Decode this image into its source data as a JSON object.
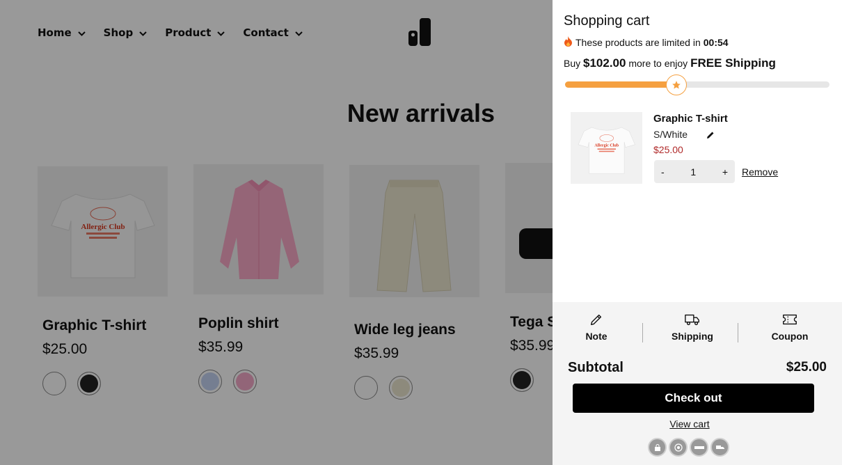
{
  "nav": {
    "items": [
      {
        "label": "Home"
      },
      {
        "label": "Shop"
      },
      {
        "label": "Product"
      },
      {
        "label": "Contact"
      }
    ]
  },
  "section": {
    "title": "New arrivals"
  },
  "products": [
    {
      "name": "Graphic T-shirt",
      "price": "$25.00",
      "swatches": [
        "#ffffff",
        "#222222"
      ]
    },
    {
      "name": "Poplin shirt",
      "price": "$35.99",
      "swatches": [
        "#c4d3f2",
        "#f4a9c8"
      ]
    },
    {
      "name": "Wide leg jeans",
      "price": "$35.99",
      "swatches": [
        "#ffffff",
        "#ece6cf"
      ]
    },
    {
      "name": "Tega Sunglasses",
      "price": "$35.99",
      "swatches": [
        "#222222"
      ]
    }
  ],
  "cart": {
    "title": "Shopping cart",
    "limit_text": "These products are limited in",
    "timer": "00:54",
    "buy_prefix": "Buy",
    "remaining_amount": "$102.00",
    "buy_middle": "more to enjoy",
    "free_shipping": "FREE Shipping",
    "progress": 0.42,
    "item": {
      "name": "Graphic T-shirt",
      "variant": "S/White",
      "price": "$25.00",
      "quantity": "1",
      "minus": "-",
      "plus": "+",
      "remove_label": "Remove"
    },
    "tools": {
      "note": "Note",
      "shipping": "Shipping",
      "coupon": "Coupon"
    },
    "subtotal_label": "Subtotal",
    "subtotal_value": "$25.00",
    "checkout_label": "Check out",
    "view_cart_label": "View cart"
  },
  "colors": {
    "accent": "#f5a040",
    "price_red": "#b02a2a",
    "overlay": "rgba(0,0,0,0.4)"
  }
}
